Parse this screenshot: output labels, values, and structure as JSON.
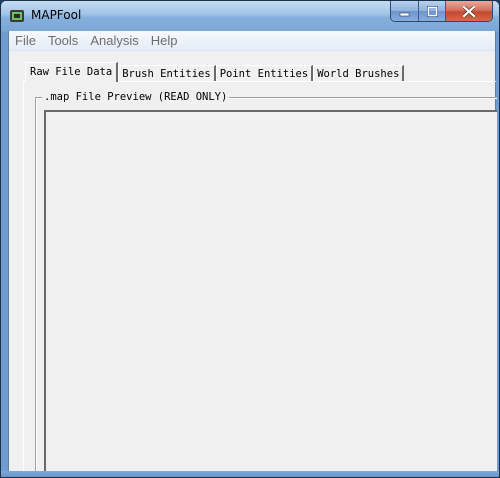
{
  "window": {
    "title": "MAPFool",
    "controls": {
      "minimize": "-",
      "maximize": "□",
      "close": "x"
    }
  },
  "menu": {
    "items": [
      "File",
      "Tools",
      "Analysis",
      "Help"
    ]
  },
  "tabs": [
    {
      "label": "Raw File Data",
      "active": true
    },
    {
      "label": "Brush Entities",
      "active": false
    },
    {
      "label": "Point Entities",
      "active": false
    },
    {
      "label": "World Brushes",
      "active": false
    }
  ],
  "panel": {
    "group_label": ".map File Preview (READ ONLY)",
    "preview_text": ""
  },
  "icons": {
    "app": "app-logo-icon"
  },
  "colors": {
    "titlebar": "#9fc2e6",
    "close_button": "#c24a31",
    "client_bg": "#f0f0f0"
  }
}
